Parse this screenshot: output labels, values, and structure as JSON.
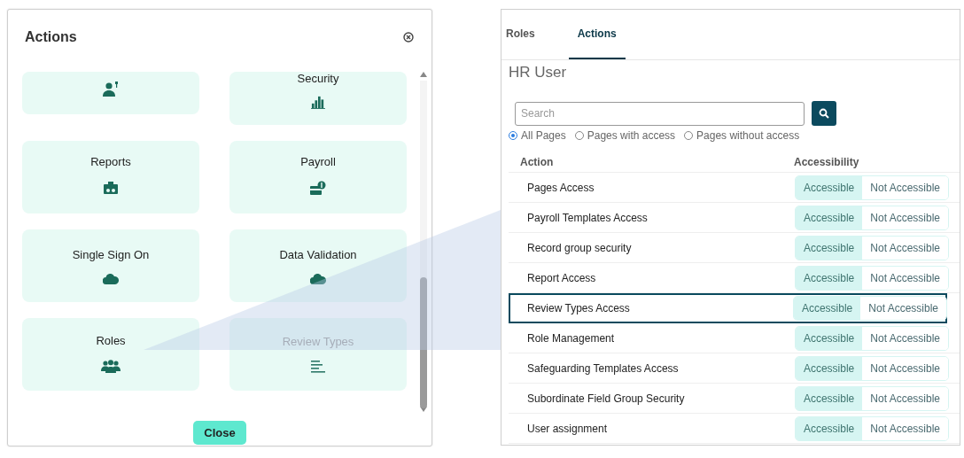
{
  "dialog": {
    "title": "Actions",
    "cards": [
      {
        "disabled": false
      },
      {
        "label": "Security",
        "disabled": false
      },
      {
        "label": "Reports",
        "disabled": false
      },
      {
        "label": "Payroll",
        "disabled": false
      },
      {
        "label": "Single Sign On",
        "disabled": false
      },
      {
        "label": "Data Validation",
        "disabled": false
      },
      {
        "label": "Roles",
        "disabled": false
      },
      {
        "label": "Review Types",
        "disabled": true
      }
    ],
    "close_button": "Close"
  },
  "panel": {
    "tabs": [
      {
        "label": "Roles",
        "selected": false
      },
      {
        "label": "Actions",
        "selected": true
      }
    ],
    "role_name": "HR User",
    "search": {
      "placeholder": "Search"
    },
    "filters": [
      {
        "label": "All Pages",
        "selected": true
      },
      {
        "label": "Pages with access",
        "selected": false
      },
      {
        "label": "Pages without access",
        "selected": false
      }
    ],
    "table": {
      "columns": [
        "Action",
        "Accessibility"
      ],
      "rows": [
        {
          "action": "Pages Access",
          "highlighted": false,
          "options": [
            {
              "label": "Accessible",
              "selected": true
            },
            {
              "label": "Not Accessible",
              "selected": false
            }
          ]
        },
        {
          "action": "Payroll Templates Access",
          "highlighted": false,
          "options": [
            {
              "label": "Accessible",
              "selected": true
            },
            {
              "label": "Not Accessible",
              "selected": false
            }
          ]
        },
        {
          "action": "Record group security",
          "highlighted": false,
          "options": [
            {
              "label": "Accessible",
              "selected": true
            },
            {
              "label": "Not Accessible",
              "selected": false
            }
          ]
        },
        {
          "action": "Report Access",
          "highlighted": false,
          "options": [
            {
              "label": "Accessible",
              "selected": true
            },
            {
              "label": "Not Accessible",
              "selected": false
            }
          ]
        },
        {
          "action": "Review Types Access",
          "highlighted": true,
          "options": [
            {
              "label": "Accessible",
              "selected": true
            },
            {
              "label": "Not Accessible",
              "selected": false
            }
          ]
        },
        {
          "action": "Role Management",
          "highlighted": false,
          "options": [
            {
              "label": "Accessible",
              "selected": true
            },
            {
              "label": "Not Accessible",
              "selected": false
            }
          ]
        },
        {
          "action": "Safeguarding Templates Access",
          "highlighted": false,
          "options": [
            {
              "label": "Accessible",
              "selected": true
            },
            {
              "label": "Not Accessible",
              "selected": false
            }
          ]
        },
        {
          "action": "Subordinate Field Group Security",
          "highlighted": false,
          "options": [
            {
              "label": "Accessible",
              "selected": true
            },
            {
              "label": "Not Accessible",
              "selected": false
            }
          ]
        },
        {
          "action": "User assignment",
          "highlighted": false,
          "options": [
            {
              "label": "Accessible",
              "selected": true
            },
            {
              "label": "Not Accessible",
              "selected": false
            }
          ]
        }
      ]
    }
  }
}
